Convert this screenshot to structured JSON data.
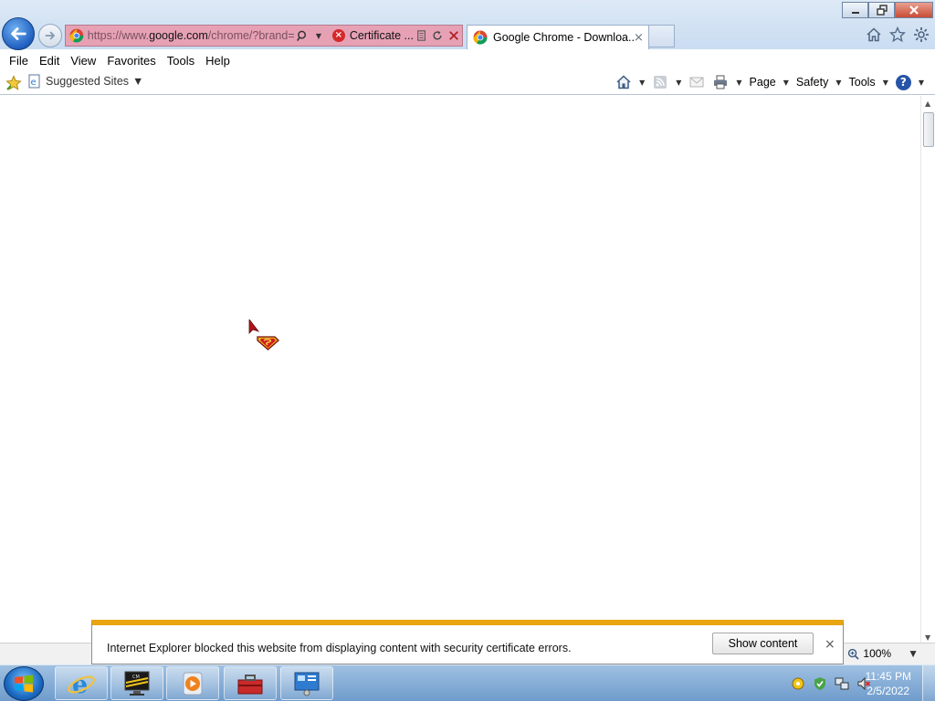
{
  "browser": {
    "address_bar": {
      "url_prefix": "https://www.",
      "url_domain": "google.com",
      "url_rest": "/chrome/?brand=",
      "certificate_label": "Certificate ...",
      "icons": [
        "search-icon",
        "dropdown-arrow",
        "certificate-error-icon",
        "compatibility-icon",
        "refresh-icon",
        "stop-icon"
      ]
    },
    "tab": {
      "title": "Google Chrome - Downloa...",
      "close": "×"
    }
  },
  "menubar": {
    "items": [
      "File",
      "Edit",
      "View",
      "Favorites",
      "Tools",
      "Help"
    ]
  },
  "favorites_bar": {
    "suggested_sites": "Suggested Sites"
  },
  "command_bar": {
    "page": "Page",
    "safety": "Safety",
    "tools": "Tools",
    "help": "?"
  },
  "notification": {
    "message": "Internet Explorer blocked this website from displaying content with security certificate errors.",
    "button": "Show content",
    "close": "×"
  },
  "statusbar": {
    "zoom": "100%"
  },
  "taskbar": {
    "pinned": [
      "internet-explorer",
      "cm-monitor",
      "media-player",
      "toolbox",
      "control-panel"
    ],
    "clock_time": "11:45 PM",
    "clock_date": "2/5/2022"
  },
  "colors": {
    "cert_error_address_bg": "#e6a1b5",
    "notification_accent": "#e8a50f",
    "taskbar": "#8fb3da"
  }
}
